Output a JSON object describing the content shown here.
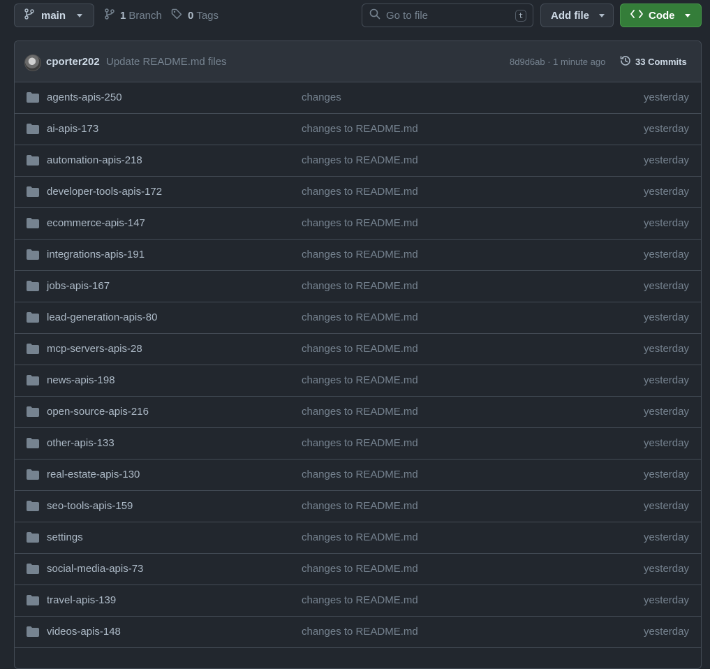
{
  "toolbar": {
    "branch_name": "main",
    "branch_count": "1",
    "branch_label": "Branch",
    "tag_count": "0",
    "tag_label": "Tags",
    "search_placeholder": "Go to file",
    "search_shortcut": "t",
    "add_file_label": "Add file",
    "code_label": "Code"
  },
  "commit": {
    "author": "cporter202",
    "message": "Update README.md files",
    "hash_time": "8d9d6ab · 1 minute ago",
    "commits_count": "33 Commits"
  },
  "files": [
    {
      "name": "agents-apis-250",
      "message": "changes",
      "date": "yesterday"
    },
    {
      "name": "ai-apis-173",
      "message": "changes to README.md",
      "date": "yesterday"
    },
    {
      "name": "automation-apis-218",
      "message": "changes to README.md",
      "date": "yesterday"
    },
    {
      "name": "developer-tools-apis-172",
      "message": "changes to README.md",
      "date": "yesterday"
    },
    {
      "name": "ecommerce-apis-147",
      "message": "changes to README.md",
      "date": "yesterday"
    },
    {
      "name": "integrations-apis-191",
      "message": "changes to README.md",
      "date": "yesterday"
    },
    {
      "name": "jobs-apis-167",
      "message": "changes to README.md",
      "date": "yesterday"
    },
    {
      "name": "lead-generation-apis-80",
      "message": "changes to README.md",
      "date": "yesterday"
    },
    {
      "name": "mcp-servers-apis-28",
      "message": "changes to README.md",
      "date": "yesterday"
    },
    {
      "name": "news-apis-198",
      "message": "changes to README.md",
      "date": "yesterday"
    },
    {
      "name": "open-source-apis-216",
      "message": "changes to README.md",
      "date": "yesterday"
    },
    {
      "name": "other-apis-133",
      "message": "changes to README.md",
      "date": "yesterday"
    },
    {
      "name": "real-estate-apis-130",
      "message": "changes to README.md",
      "date": "yesterday"
    },
    {
      "name": "seo-tools-apis-159",
      "message": "changes to README.md",
      "date": "yesterday"
    },
    {
      "name": "settings",
      "message": "changes to README.md",
      "date": "yesterday"
    },
    {
      "name": "social-media-apis-73",
      "message": "changes to README.md",
      "date": "yesterday"
    },
    {
      "name": "travel-apis-139",
      "message": "changes to README.md",
      "date": "yesterday"
    },
    {
      "name": "videos-apis-148",
      "message": "changes to README.md",
      "date": "yesterday"
    }
  ],
  "colors": {
    "background": "#22272e",
    "border": "#444c56",
    "code_button": "#347d39",
    "folder_icon": "#768390"
  }
}
